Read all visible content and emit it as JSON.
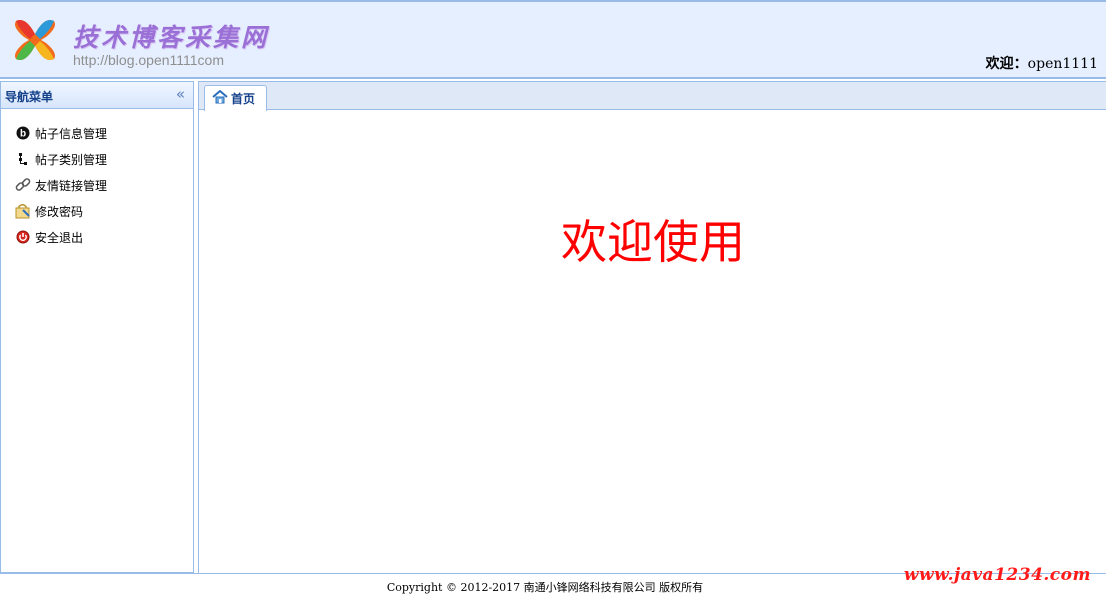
{
  "header": {
    "logo_title": "技术博客采集网",
    "logo_url": "http://blog.open1111com",
    "welcome_label": "欢迎：",
    "username": "open1111"
  },
  "sidebar": {
    "title": "导航菜单",
    "items": [
      {
        "label": "帖子信息管理",
        "icon": "blog-icon"
      },
      {
        "label": "帖子类别管理",
        "icon": "tree-icon"
      },
      {
        "label": "友情链接管理",
        "icon": "link-icon"
      },
      {
        "label": "修改密码",
        "icon": "lock-icon"
      },
      {
        "label": "安全退出",
        "icon": "exit-icon"
      }
    ]
  },
  "main": {
    "tabs": [
      {
        "label": "首页",
        "icon": "home-icon"
      }
    ],
    "welcome_text": "欢迎使用"
  },
  "footer": {
    "copyright": "Copyright © 2012-2017 南通小锋网络科技有限公司 版权所有",
    "watermark": "www.java1234.com"
  },
  "colors": {
    "border": "#99bbe8",
    "header_bg": "#e6efff",
    "accent_text": "#15428b",
    "welcome_red": "#ff0000"
  }
}
